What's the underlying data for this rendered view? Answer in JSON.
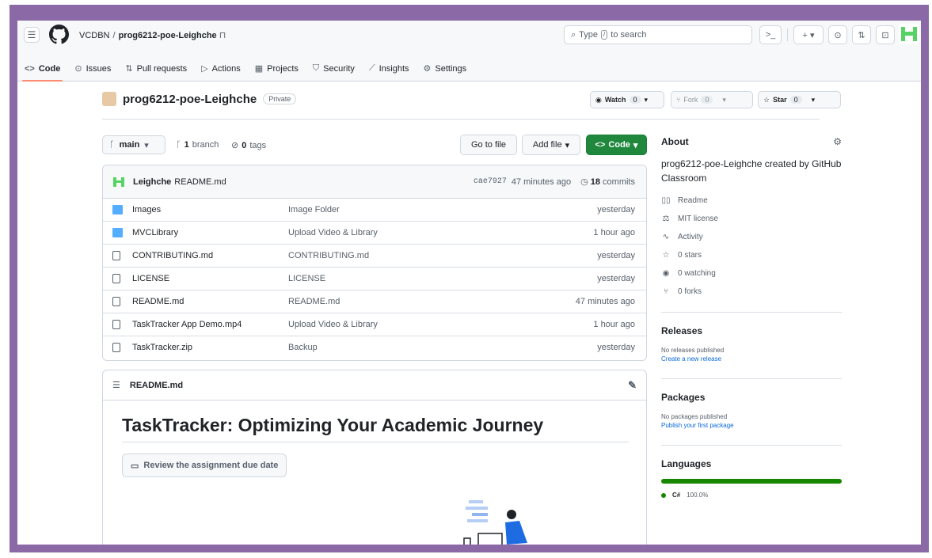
{
  "header": {
    "owner": "VCDBN",
    "separator": "/",
    "repo": "prog6212-poe-Leighche",
    "search_prefix": "Type",
    "search_key": "/",
    "search_suffix": "to search",
    "terminal_label": ">_",
    "plus_label": "+ ▾"
  },
  "nav": {
    "tabs": [
      {
        "label": "Code",
        "icon": "code-icon"
      },
      {
        "label": "Issues",
        "icon": "issue-icon"
      },
      {
        "label": "Pull requests",
        "icon": "pull-request-icon"
      },
      {
        "label": "Actions",
        "icon": "play-icon"
      },
      {
        "label": "Projects",
        "icon": "table-icon"
      },
      {
        "label": "Security",
        "icon": "shield-icon"
      },
      {
        "label": "Insights",
        "icon": "graph-icon"
      },
      {
        "label": "Settings",
        "icon": "gear-icon"
      }
    ],
    "active": "Code"
  },
  "repo": {
    "name": "prog6212-poe-Leighche",
    "visibility": "Private",
    "watch_label": "Watch",
    "watch_count": "0",
    "fork_label": "Fork",
    "fork_count": "0",
    "star_label": "Star",
    "star_count": "0"
  },
  "branchbar": {
    "branch": "main",
    "branch_count": "1",
    "branch_word": "branch",
    "tag_count": "0",
    "tag_word": "tags",
    "go_to_file": "Go to file",
    "add_file": "Add file",
    "code": "Code"
  },
  "commit": {
    "author": "Leighche",
    "message": "README.md",
    "hash": "cae7927",
    "time": "47 minutes ago",
    "count": "18",
    "count_word": "commits"
  },
  "files": [
    {
      "name": "Images",
      "type": "folder",
      "message": "Image Folder",
      "date": "yesterday"
    },
    {
      "name": "MVCLibrary",
      "type": "folder",
      "message": "Upload Video & Library",
      "date": "1 hour ago"
    },
    {
      "name": "CONTRIBUTING.md",
      "type": "file",
      "message": "CONTRIBUTING.md",
      "date": "yesterday"
    },
    {
      "name": "LICENSE",
      "type": "file",
      "message": "LICENSE",
      "date": "yesterday"
    },
    {
      "name": "README.md",
      "type": "file",
      "message": "README.md",
      "date": "47 minutes ago"
    },
    {
      "name": "TaskTracker App Demo.mp4",
      "type": "file",
      "message": "Upload Video & Library",
      "date": "1 hour ago"
    },
    {
      "name": "TaskTracker.zip",
      "type": "file",
      "message": "Backup",
      "date": "yesterday"
    }
  ],
  "readme": {
    "filename": "README.md",
    "title": "TaskTracker: Optimizing Your Academic Journey",
    "review_button": "Review the assignment due date"
  },
  "about": {
    "heading": "About",
    "description": "prog6212-poe-Leighche created by GitHub Classroom",
    "links": [
      {
        "icon": "book-icon",
        "label": "Readme"
      },
      {
        "icon": "law-icon",
        "label": "MIT license"
      },
      {
        "icon": "pulse-icon",
        "label": "Activity"
      },
      {
        "icon": "star-icon",
        "label": "0 stars"
      },
      {
        "icon": "eye-icon",
        "label": "0 watching"
      },
      {
        "icon": "fork-icon",
        "label": "0 forks"
      }
    ]
  },
  "releases": {
    "heading": "Releases",
    "status": "No releases published",
    "link": "Create a new release"
  },
  "packages": {
    "heading": "Packages",
    "status": "No packages published",
    "link": "Publish your first package"
  },
  "languages": {
    "heading": "Languages",
    "items": [
      {
        "name": "C#",
        "percent": "100.0%",
        "color": "#178600",
        "fraction": 1.0
      }
    ]
  },
  "colors": {
    "frame": "#8b68a6",
    "primary_button": "#1f883d",
    "link": "#0969da",
    "folder": "#54aeff",
    "active_tab_underline": "#fd8c73"
  }
}
